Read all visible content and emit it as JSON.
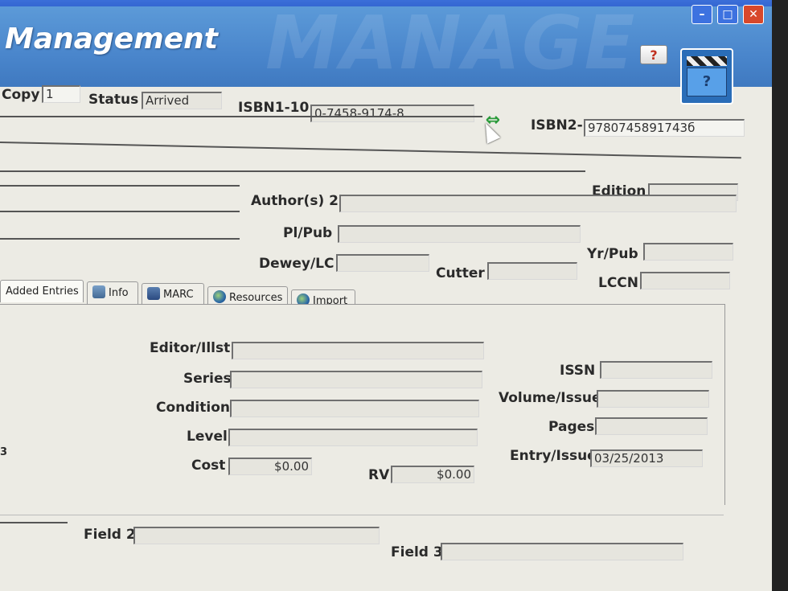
{
  "window": {
    "title": "Management",
    "watermark": "MANAGE",
    "controls": {
      "minimize": "–",
      "maximize": "□",
      "close": "✕"
    },
    "help_label": "?"
  },
  "record": {
    "copy_label": "Copy",
    "copy_value": "1",
    "status_label": "Status",
    "status_value": "Arrived",
    "isbn10_label": "ISBN1-10",
    "isbn10_value": "0-7458-9174-8",
    "isbn13_label": "ISBN2-",
    "isbn13_value": "9780745891743б",
    "edition_label": "Edition",
    "edition_value": "",
    "authors2_label": "Author(s) 2",
    "authors2_value": "",
    "plpub_label": "Pl/Pub",
    "plpub_value": "",
    "yrpub_label": "Yr/Pub",
    "yrpub_value": "",
    "dewey_label": "Dewey/LC",
    "dewey_value": "",
    "cutter_label": "Cutter",
    "cutter_value": "",
    "lccn_label": "LCCN",
    "lccn_value": ""
  },
  "tabs": [
    {
      "label": "Added Entries",
      "icon": "none"
    },
    {
      "label": "Info",
      "icon": "info-icon"
    },
    {
      "label": "MARC",
      "icon": "marc-icon"
    },
    {
      "label": "Resources",
      "icon": "globe-icon"
    },
    {
      "label": "Import",
      "icon": "globe-icon"
    }
  ],
  "added_entries": {
    "editor_label": "Editor/Illst",
    "editor_value": "",
    "series_label": "Series",
    "series_value": "",
    "condition_label": "Condition",
    "condition_value": "",
    "level_label": "Level",
    "level_value": "",
    "cost_label": "Cost",
    "cost_value": "$0.00",
    "rv_label": "RV",
    "rv_value": "$0.00",
    "issn_label": "ISSN",
    "issn_value": "",
    "volume_label": "Volume/Issue",
    "volume_value": "",
    "pages_label": "Pages",
    "pages_value": "",
    "entry_label": "Entry/Issue",
    "entry_value": "03/25/2013",
    "edge_glyph": "3"
  },
  "fields": {
    "field2_label": "Field 2",
    "field2_value": "",
    "field3_label": "Field 3",
    "field3_value": ""
  },
  "colors": {
    "banner": "#4a86cc",
    "close_button": "#d8482a",
    "link_icon": "#2a9a3a"
  }
}
